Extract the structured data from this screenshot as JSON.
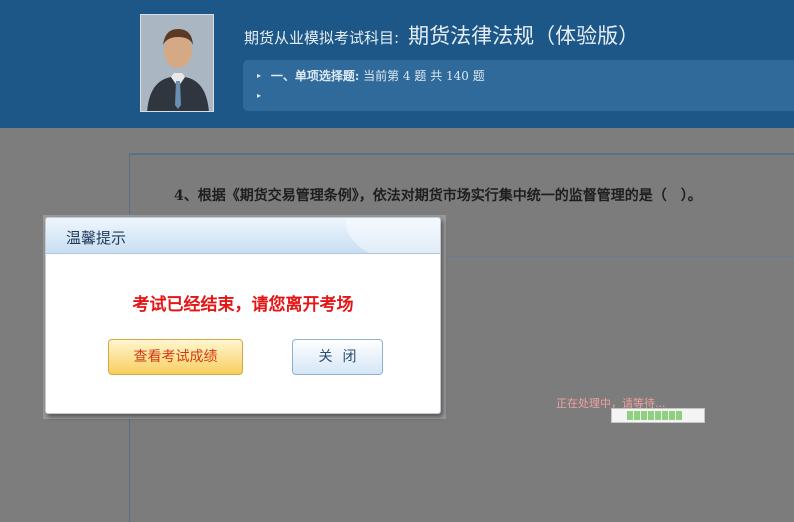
{
  "header": {
    "title_prefix": "期货从业模拟考试科目:",
    "subject": "期货法律法规（体验版）",
    "section_label": "一、单项选择题:",
    "progress_text": "当前第 4 题 共 140 题"
  },
  "question": {
    "text": "4、根据《期货交易管理条例》，依法对期货市场实行集中统一的监督管理的是（　）。"
  },
  "dialog": {
    "title": "温馨提示",
    "message": "考试已经结束，请您离开考场",
    "view_score_label": "查看考试成绩",
    "close_label": "关闭"
  },
  "processing": {
    "text": "正在处理中，请等待...",
    "progress_fraction": 0.8
  },
  "colors": {
    "header_bg": "#1c5787",
    "overlay_bg": "#7d7d7d",
    "message_red": "#e51515",
    "progress_green": "#8ed07d"
  },
  "icons": {
    "arrow": "triangle-right"
  }
}
